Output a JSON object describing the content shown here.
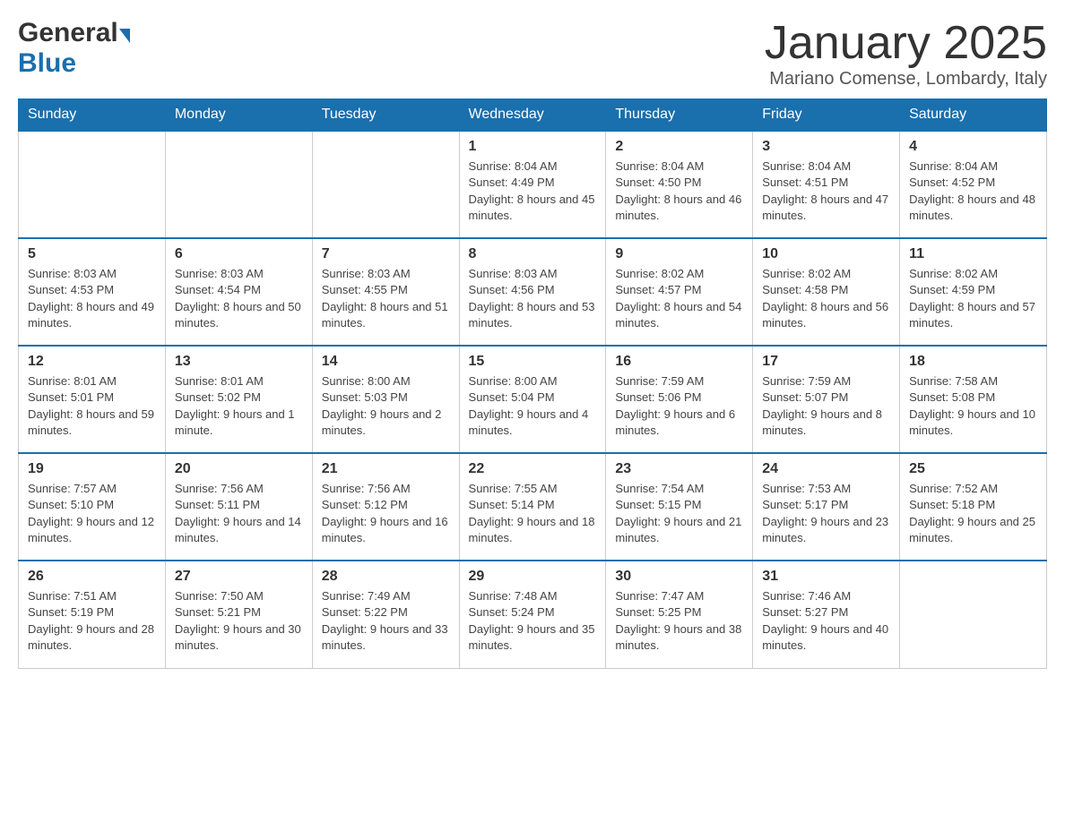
{
  "header": {
    "logo_general": "General",
    "logo_blue": "Blue",
    "month_title": "January 2025",
    "location": "Mariano Comense, Lombardy, Italy"
  },
  "days_of_week": [
    "Sunday",
    "Monday",
    "Tuesday",
    "Wednesday",
    "Thursday",
    "Friday",
    "Saturday"
  ],
  "weeks": [
    [
      {
        "day": "",
        "info": ""
      },
      {
        "day": "",
        "info": ""
      },
      {
        "day": "",
        "info": ""
      },
      {
        "day": "1",
        "info": "Sunrise: 8:04 AM\nSunset: 4:49 PM\nDaylight: 8 hours and 45 minutes."
      },
      {
        "day": "2",
        "info": "Sunrise: 8:04 AM\nSunset: 4:50 PM\nDaylight: 8 hours and 46 minutes."
      },
      {
        "day": "3",
        "info": "Sunrise: 8:04 AM\nSunset: 4:51 PM\nDaylight: 8 hours and 47 minutes."
      },
      {
        "day": "4",
        "info": "Sunrise: 8:04 AM\nSunset: 4:52 PM\nDaylight: 8 hours and 48 minutes."
      }
    ],
    [
      {
        "day": "5",
        "info": "Sunrise: 8:03 AM\nSunset: 4:53 PM\nDaylight: 8 hours and 49 minutes."
      },
      {
        "day": "6",
        "info": "Sunrise: 8:03 AM\nSunset: 4:54 PM\nDaylight: 8 hours and 50 minutes."
      },
      {
        "day": "7",
        "info": "Sunrise: 8:03 AM\nSunset: 4:55 PM\nDaylight: 8 hours and 51 minutes."
      },
      {
        "day": "8",
        "info": "Sunrise: 8:03 AM\nSunset: 4:56 PM\nDaylight: 8 hours and 53 minutes."
      },
      {
        "day": "9",
        "info": "Sunrise: 8:02 AM\nSunset: 4:57 PM\nDaylight: 8 hours and 54 minutes."
      },
      {
        "day": "10",
        "info": "Sunrise: 8:02 AM\nSunset: 4:58 PM\nDaylight: 8 hours and 56 minutes."
      },
      {
        "day": "11",
        "info": "Sunrise: 8:02 AM\nSunset: 4:59 PM\nDaylight: 8 hours and 57 minutes."
      }
    ],
    [
      {
        "day": "12",
        "info": "Sunrise: 8:01 AM\nSunset: 5:01 PM\nDaylight: 8 hours and 59 minutes."
      },
      {
        "day": "13",
        "info": "Sunrise: 8:01 AM\nSunset: 5:02 PM\nDaylight: 9 hours and 1 minute."
      },
      {
        "day": "14",
        "info": "Sunrise: 8:00 AM\nSunset: 5:03 PM\nDaylight: 9 hours and 2 minutes."
      },
      {
        "day": "15",
        "info": "Sunrise: 8:00 AM\nSunset: 5:04 PM\nDaylight: 9 hours and 4 minutes."
      },
      {
        "day": "16",
        "info": "Sunrise: 7:59 AM\nSunset: 5:06 PM\nDaylight: 9 hours and 6 minutes."
      },
      {
        "day": "17",
        "info": "Sunrise: 7:59 AM\nSunset: 5:07 PM\nDaylight: 9 hours and 8 minutes."
      },
      {
        "day": "18",
        "info": "Sunrise: 7:58 AM\nSunset: 5:08 PM\nDaylight: 9 hours and 10 minutes."
      }
    ],
    [
      {
        "day": "19",
        "info": "Sunrise: 7:57 AM\nSunset: 5:10 PM\nDaylight: 9 hours and 12 minutes."
      },
      {
        "day": "20",
        "info": "Sunrise: 7:56 AM\nSunset: 5:11 PM\nDaylight: 9 hours and 14 minutes."
      },
      {
        "day": "21",
        "info": "Sunrise: 7:56 AM\nSunset: 5:12 PM\nDaylight: 9 hours and 16 minutes."
      },
      {
        "day": "22",
        "info": "Sunrise: 7:55 AM\nSunset: 5:14 PM\nDaylight: 9 hours and 18 minutes."
      },
      {
        "day": "23",
        "info": "Sunrise: 7:54 AM\nSunset: 5:15 PM\nDaylight: 9 hours and 21 minutes."
      },
      {
        "day": "24",
        "info": "Sunrise: 7:53 AM\nSunset: 5:17 PM\nDaylight: 9 hours and 23 minutes."
      },
      {
        "day": "25",
        "info": "Sunrise: 7:52 AM\nSunset: 5:18 PM\nDaylight: 9 hours and 25 minutes."
      }
    ],
    [
      {
        "day": "26",
        "info": "Sunrise: 7:51 AM\nSunset: 5:19 PM\nDaylight: 9 hours and 28 minutes."
      },
      {
        "day": "27",
        "info": "Sunrise: 7:50 AM\nSunset: 5:21 PM\nDaylight: 9 hours and 30 minutes."
      },
      {
        "day": "28",
        "info": "Sunrise: 7:49 AM\nSunset: 5:22 PM\nDaylight: 9 hours and 33 minutes."
      },
      {
        "day": "29",
        "info": "Sunrise: 7:48 AM\nSunset: 5:24 PM\nDaylight: 9 hours and 35 minutes."
      },
      {
        "day": "30",
        "info": "Sunrise: 7:47 AM\nSunset: 5:25 PM\nDaylight: 9 hours and 38 minutes."
      },
      {
        "day": "31",
        "info": "Sunrise: 7:46 AM\nSunset: 5:27 PM\nDaylight: 9 hours and 40 minutes."
      },
      {
        "day": "",
        "info": ""
      }
    ]
  ]
}
